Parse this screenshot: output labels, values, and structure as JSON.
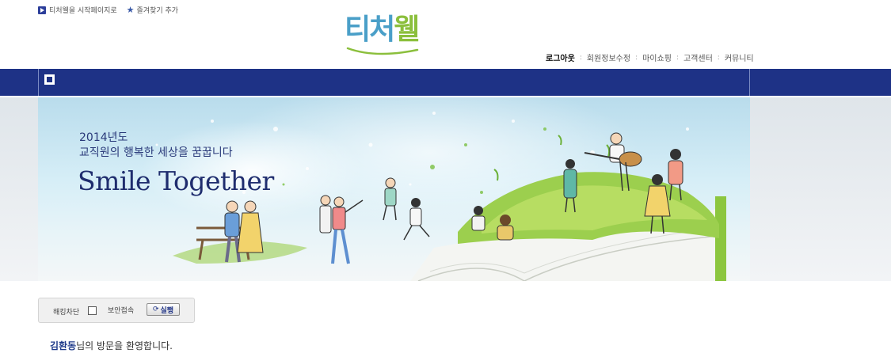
{
  "util": {
    "startpage_label": "티처웰을 시작페이지로",
    "favorite_label": "즐겨찾기 추가"
  },
  "logo": {
    "part1": "티처",
    "part2": "웰"
  },
  "gnb": {
    "items": [
      "로그아웃",
      "회원정보수정",
      "마이쇼핑",
      "고객센터",
      "커뮤니티"
    ],
    "separator": ":"
  },
  "banner": {
    "year": "2014년도",
    "subtitle": "교직원의 행복한 세상을 꿈꿉니다",
    "title": "Smile Together"
  },
  "security": {
    "hacking_block_label": "해킹차단",
    "secure_access_label": "보안접속",
    "run_button_label": "실행",
    "hacking_block_checked": false
  },
  "welcome": {
    "user_name": "김환동",
    "message": "님의 방문을 환영합니다."
  },
  "colors": {
    "nav_bar": "#1e3286",
    "logo_blue": "#4a9fc8",
    "logo_green": "#8bbf3c"
  }
}
